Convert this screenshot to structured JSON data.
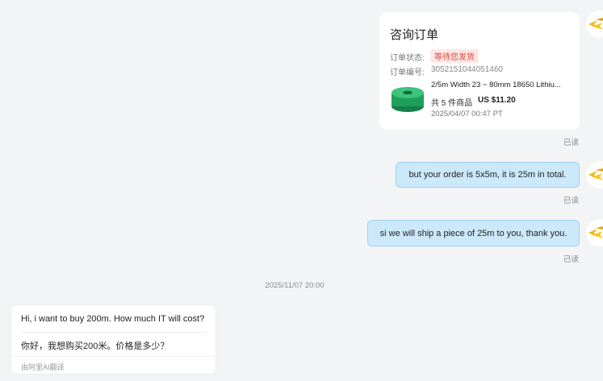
{
  "order_card": {
    "title": "咨询订单",
    "status_label": "订单状态:",
    "status_value": "等待您发货",
    "order_no_label": "订单编号:",
    "order_no": "3052151044051460",
    "product_name": "2/5m Width 23 ~ 80mm 18650 Lithiu...",
    "quantity": "共 5 件商品",
    "price": "US $11.20",
    "date": "2025/04/07 00:47 PT"
  },
  "messages_out": [
    {
      "text": "but your order is 5x5m, it is 25m in total.",
      "read": "已读"
    },
    {
      "text": "si we will ship a piece of 25m to you, thank you.",
      "read": "已读"
    }
  ],
  "order_read": "已读",
  "timestamp": "2025/11/07 20:00",
  "message_in": {
    "original": "Hi, i want to buy 200m. How much IT will cost?",
    "translation": "你好，我想购买200米。价格是多少？",
    "translated_by": "由阿里AI翻译"
  },
  "colors": {
    "sent_bubble": "#cce8fb",
    "status_red": "#e0453a",
    "product_green": "#1fa05a"
  }
}
